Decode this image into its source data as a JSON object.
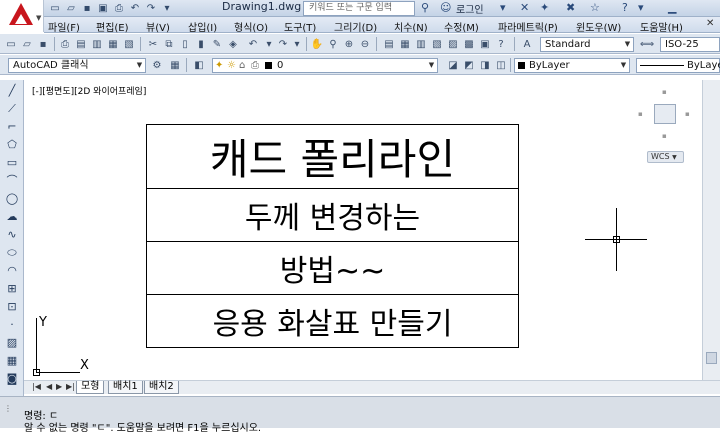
{
  "titlebar": {
    "document_title": "Drawing1.dwg",
    "search_placeholder": "키워드 또는 구문 입력",
    "login_label": "로그인",
    "help_label": "?"
  },
  "menubar": {
    "items": [
      "파일(F)",
      "편집(E)",
      "뷰(V)",
      "삽입(I)",
      "형식(O)",
      "도구(T)",
      "그리기(D)",
      "치수(N)",
      "수정(M)",
      "파라메트릭(P)",
      "윈도우(W)",
      "도움말(H)"
    ]
  },
  "toolbar_standard": {
    "text_style": "Standard",
    "dim_style": "ISO-25"
  },
  "toolbar_layers": {
    "workspace": "AutoCAD 클래식",
    "layer": "0",
    "color": "ByLayer",
    "linetype": "ByLaye"
  },
  "viewport": {
    "label": "[-][평면도][2D 와이어프레임]",
    "wcs_label": "WCS"
  },
  "drawing": {
    "row1": "캐드 폴리라인",
    "row2": "두께 변경하는",
    "row3": "방법~~",
    "row4": "응용 화살표 만들기"
  },
  "ucs": {
    "x_label": "X",
    "y_label": "Y"
  },
  "tabs": [
    "모형",
    "배치1",
    "배치2"
  ],
  "command": {
    "line1": "명령: ㄷ",
    "line2": "알 수 없는 명령 \"ㄷ\". 도움말을 보려면 F1을 누르십시오."
  },
  "colors": {
    "toolbar_bg": "#dee6f0",
    "logo_red": "#c8161d",
    "canvas_bg": "#ffffff"
  }
}
